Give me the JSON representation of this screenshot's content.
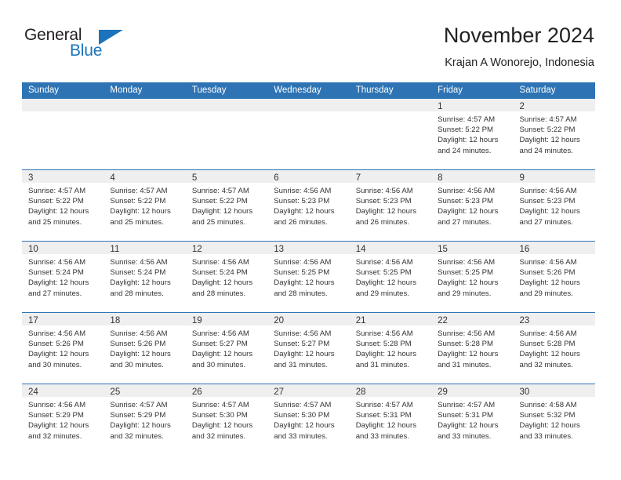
{
  "brand": {
    "word_one": "General",
    "word_two": "Blue",
    "logo_icon": "triangle-logo-icon",
    "color_blue": "#1b74bb",
    "color_dark": "#231f20"
  },
  "header": {
    "title": "November 2024",
    "subtitle": "Krajan A Wonorejo, Indonesia"
  },
  "calendar": {
    "accent_color": "#2e74b5",
    "banner_color": "#efefef",
    "weekdays": [
      "Sunday",
      "Monday",
      "Tuesday",
      "Wednesday",
      "Thursday",
      "Friday",
      "Saturday"
    ],
    "weeks": [
      [
        {
          "day": "",
          "lines": []
        },
        {
          "day": "",
          "lines": []
        },
        {
          "day": "",
          "lines": []
        },
        {
          "day": "",
          "lines": []
        },
        {
          "day": "",
          "lines": []
        },
        {
          "day": "1",
          "lines": [
            "Sunrise: 4:57 AM",
            "Sunset: 5:22 PM",
            "Daylight: 12 hours",
            "and 24 minutes."
          ]
        },
        {
          "day": "2",
          "lines": [
            "Sunrise: 4:57 AM",
            "Sunset: 5:22 PM",
            "Daylight: 12 hours",
            "and 24 minutes."
          ]
        }
      ],
      [
        {
          "day": "3",
          "lines": [
            "Sunrise: 4:57 AM",
            "Sunset: 5:22 PM",
            "Daylight: 12 hours",
            "and 25 minutes."
          ]
        },
        {
          "day": "4",
          "lines": [
            "Sunrise: 4:57 AM",
            "Sunset: 5:22 PM",
            "Daylight: 12 hours",
            "and 25 minutes."
          ]
        },
        {
          "day": "5",
          "lines": [
            "Sunrise: 4:57 AM",
            "Sunset: 5:22 PM",
            "Daylight: 12 hours",
            "and 25 minutes."
          ]
        },
        {
          "day": "6",
          "lines": [
            "Sunrise: 4:56 AM",
            "Sunset: 5:23 PM",
            "Daylight: 12 hours",
            "and 26 minutes."
          ]
        },
        {
          "day": "7",
          "lines": [
            "Sunrise: 4:56 AM",
            "Sunset: 5:23 PM",
            "Daylight: 12 hours",
            "and 26 minutes."
          ]
        },
        {
          "day": "8",
          "lines": [
            "Sunrise: 4:56 AM",
            "Sunset: 5:23 PM",
            "Daylight: 12 hours",
            "and 27 minutes."
          ]
        },
        {
          "day": "9",
          "lines": [
            "Sunrise: 4:56 AM",
            "Sunset: 5:23 PM",
            "Daylight: 12 hours",
            "and 27 minutes."
          ]
        }
      ],
      [
        {
          "day": "10",
          "lines": [
            "Sunrise: 4:56 AM",
            "Sunset: 5:24 PM",
            "Daylight: 12 hours",
            "and 27 minutes."
          ]
        },
        {
          "day": "11",
          "lines": [
            "Sunrise: 4:56 AM",
            "Sunset: 5:24 PM",
            "Daylight: 12 hours",
            "and 28 minutes."
          ]
        },
        {
          "day": "12",
          "lines": [
            "Sunrise: 4:56 AM",
            "Sunset: 5:24 PM",
            "Daylight: 12 hours",
            "and 28 minutes."
          ]
        },
        {
          "day": "13",
          "lines": [
            "Sunrise: 4:56 AM",
            "Sunset: 5:25 PM",
            "Daylight: 12 hours",
            "and 28 minutes."
          ]
        },
        {
          "day": "14",
          "lines": [
            "Sunrise: 4:56 AM",
            "Sunset: 5:25 PM",
            "Daylight: 12 hours",
            "and 29 minutes."
          ]
        },
        {
          "day": "15",
          "lines": [
            "Sunrise: 4:56 AM",
            "Sunset: 5:25 PM",
            "Daylight: 12 hours",
            "and 29 minutes."
          ]
        },
        {
          "day": "16",
          "lines": [
            "Sunrise: 4:56 AM",
            "Sunset: 5:26 PM",
            "Daylight: 12 hours",
            "and 29 minutes."
          ]
        }
      ],
      [
        {
          "day": "17",
          "lines": [
            "Sunrise: 4:56 AM",
            "Sunset: 5:26 PM",
            "Daylight: 12 hours",
            "and 30 minutes."
          ]
        },
        {
          "day": "18",
          "lines": [
            "Sunrise: 4:56 AM",
            "Sunset: 5:26 PM",
            "Daylight: 12 hours",
            "and 30 minutes."
          ]
        },
        {
          "day": "19",
          "lines": [
            "Sunrise: 4:56 AM",
            "Sunset: 5:27 PM",
            "Daylight: 12 hours",
            "and 30 minutes."
          ]
        },
        {
          "day": "20",
          "lines": [
            "Sunrise: 4:56 AM",
            "Sunset: 5:27 PM",
            "Daylight: 12 hours",
            "and 31 minutes."
          ]
        },
        {
          "day": "21",
          "lines": [
            "Sunrise: 4:56 AM",
            "Sunset: 5:28 PM",
            "Daylight: 12 hours",
            "and 31 minutes."
          ]
        },
        {
          "day": "22",
          "lines": [
            "Sunrise: 4:56 AM",
            "Sunset: 5:28 PM",
            "Daylight: 12 hours",
            "and 31 minutes."
          ]
        },
        {
          "day": "23",
          "lines": [
            "Sunrise: 4:56 AM",
            "Sunset: 5:28 PM",
            "Daylight: 12 hours",
            "and 32 minutes."
          ]
        }
      ],
      [
        {
          "day": "24",
          "lines": [
            "Sunrise: 4:56 AM",
            "Sunset: 5:29 PM",
            "Daylight: 12 hours",
            "and 32 minutes."
          ]
        },
        {
          "day": "25",
          "lines": [
            "Sunrise: 4:57 AM",
            "Sunset: 5:29 PM",
            "Daylight: 12 hours",
            "and 32 minutes."
          ]
        },
        {
          "day": "26",
          "lines": [
            "Sunrise: 4:57 AM",
            "Sunset: 5:30 PM",
            "Daylight: 12 hours",
            "and 32 minutes."
          ]
        },
        {
          "day": "27",
          "lines": [
            "Sunrise: 4:57 AM",
            "Sunset: 5:30 PM",
            "Daylight: 12 hours",
            "and 33 minutes."
          ]
        },
        {
          "day": "28",
          "lines": [
            "Sunrise: 4:57 AM",
            "Sunset: 5:31 PM",
            "Daylight: 12 hours",
            "and 33 minutes."
          ]
        },
        {
          "day": "29",
          "lines": [
            "Sunrise: 4:57 AM",
            "Sunset: 5:31 PM",
            "Daylight: 12 hours",
            "and 33 minutes."
          ]
        },
        {
          "day": "30",
          "lines": [
            "Sunrise: 4:58 AM",
            "Sunset: 5:32 PM",
            "Daylight: 12 hours",
            "and 33 minutes."
          ]
        }
      ]
    ]
  }
}
